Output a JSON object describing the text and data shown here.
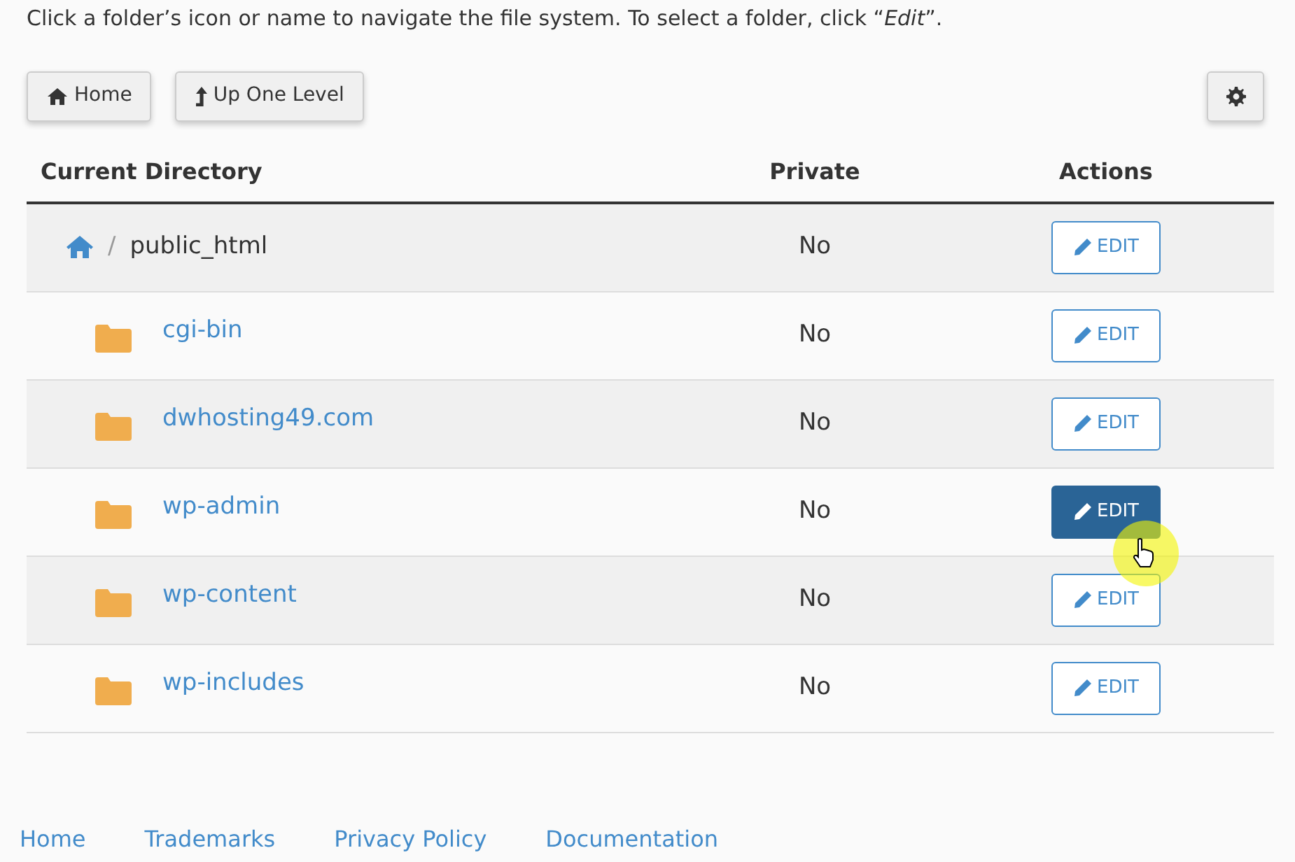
{
  "instructions": "Click a folder’s icon or name to navigate the file system. To select a folder, click “*Edit*”.",
  "toolbar": {
    "home": "Home",
    "up": "Up One Level"
  },
  "table": {
    "columns": [
      "Current Directory",
      "Private",
      "Actions"
    ],
    "rows": [
      {
        "kind": "root",
        "separator": "/",
        "name": "public_html",
        "private": "No",
        "action": "EDIT",
        "hovered": false
      },
      {
        "kind": "folder",
        "name": "cgi-bin",
        "private": "No",
        "action": "EDIT",
        "hovered": false
      },
      {
        "kind": "folder",
        "name": "dwhosting49.com",
        "private": "No",
        "action": "EDIT",
        "hovered": false
      },
      {
        "kind": "folder",
        "name": "wp-admin",
        "private": "No",
        "action": "EDIT",
        "hovered": true
      },
      {
        "kind": "folder",
        "name": "wp-content",
        "private": "No",
        "action": "EDIT",
        "hovered": false
      },
      {
        "kind": "folder",
        "name": "wp-includes",
        "private": "No",
        "action": "EDIT",
        "hovered": false
      }
    ]
  },
  "footer": [
    "Home",
    "Trademarks",
    "Privacy Policy",
    "Documentation"
  ]
}
